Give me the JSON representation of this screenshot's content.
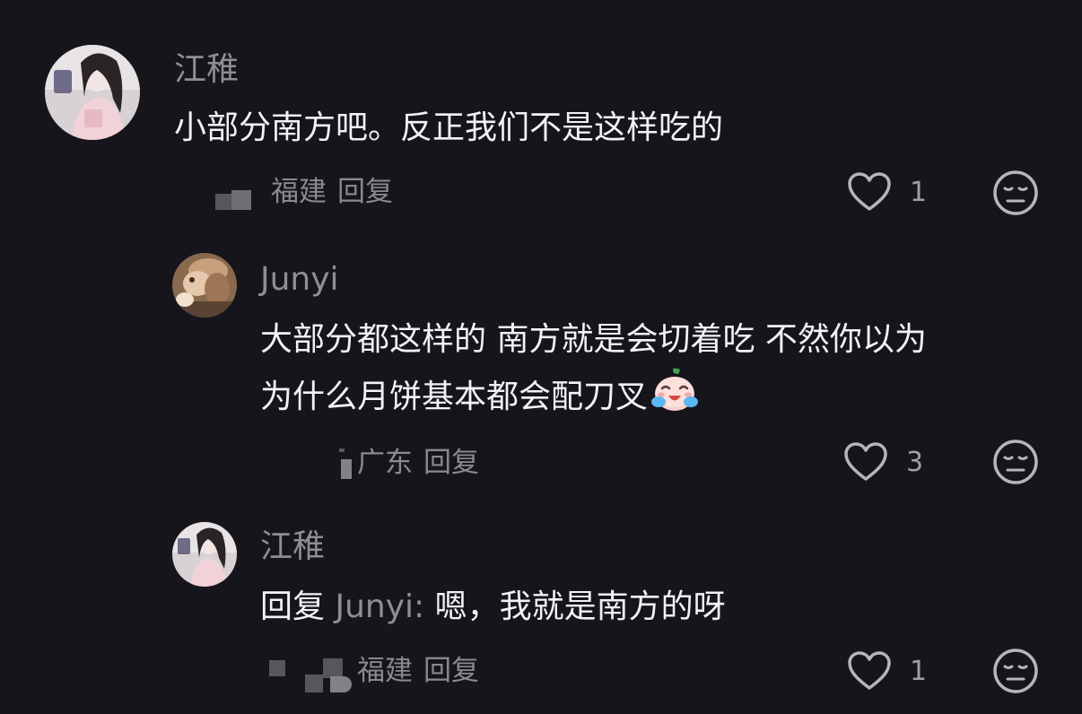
{
  "comments": [
    {
      "username": "江稚",
      "text": "小部分南方吧。反正我们不是这样吃的",
      "region": "福建",
      "reply_label": "回复",
      "like_count": "1"
    },
    {
      "username": "Junyi",
      "text_line1": "大部分都这样的 南方就是会切着吃 不然你以为",
      "text_line2": "为什么月饼基本都会配刀叉",
      "emoji": "crying-laughing-sticker",
      "region": "广东",
      "reply_label": "回复",
      "like_count": "3"
    },
    {
      "username": "江稚",
      "reply_prefix": "回复",
      "reply_target": "Junyi:",
      "text": "嗯，我就是南方的呀",
      "region": "福建",
      "reply_label": "回复",
      "like_count": "1"
    }
  ],
  "icons": {
    "like": "heart-outline-icon",
    "dislike": "unamused-face-icon"
  },
  "colors": {
    "background": "#16151b",
    "username": "#8f8e96",
    "text": "#f2f2f4",
    "meta": "#8a8990"
  }
}
